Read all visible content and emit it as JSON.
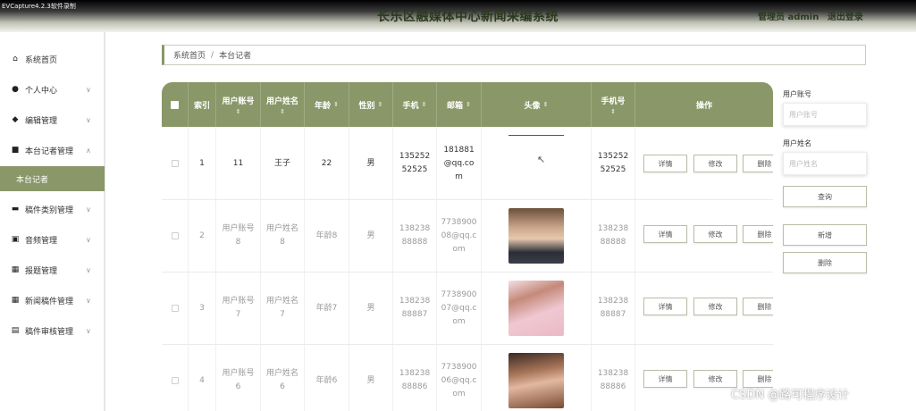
{
  "window": {
    "capture_label": "EVCapture4.2.3软件录制"
  },
  "header": {
    "title": "长乐区融媒体中心新闻采编系统",
    "user_role": "管理员 admin",
    "logout_label": "退出登录"
  },
  "sidebar": {
    "items": [
      {
        "label": "系统首页",
        "icon": "home-icon"
      },
      {
        "label": "个人中心",
        "icon": "user-icon"
      },
      {
        "label": "编辑管理",
        "icon": "edit-icon"
      },
      {
        "label": "本台记者管理",
        "icon": "reporter-icon"
      },
      {
        "label": "稿件类别管理",
        "icon": "category-icon"
      },
      {
        "label": "音频管理",
        "icon": "audio-icon"
      },
      {
        "label": "报题管理",
        "icon": "grid-icon"
      },
      {
        "label": "新闻稿件管理",
        "icon": "grid-icon"
      },
      {
        "label": "稿件审核管理",
        "icon": "review-icon"
      }
    ],
    "active_sub": "本台记者"
  },
  "breadcrumb": {
    "home": "系统首页",
    "separator": "/",
    "current": "本台记者"
  },
  "table": {
    "headers": {
      "index": "索引",
      "account": "用户账号",
      "name": "用户姓名",
      "age": "年龄",
      "gender": "性别",
      "phone": "手机",
      "email": "邮箱",
      "avatar": "头像",
      "phone_no": "手机号",
      "actions": "操作"
    },
    "rows": [
      {
        "index": "1",
        "account": "11",
        "name": "王子",
        "age": "22",
        "gender": "男",
        "phone": "13525252525",
        "email": "181881@qq.com",
        "phone_no": "13525252525"
      },
      {
        "index": "2",
        "account": "用户账号8",
        "name": "用户姓名8",
        "age": "年龄8",
        "gender": "男",
        "phone": "13823888888",
        "email": "773890008@qq.com",
        "phone_no": "13823888888"
      },
      {
        "index": "3",
        "account": "用户账号7",
        "name": "用户姓名7",
        "age": "年龄7",
        "gender": "男",
        "phone": "13823888887",
        "email": "773890007@qq.com",
        "phone_no": "13823888887"
      },
      {
        "index": "4",
        "account": "用户账号6",
        "name": "用户姓名6",
        "age": "年龄6",
        "gender": "男",
        "phone": "13823888886",
        "email": "773890006@qq.com",
        "phone_no": "13823888886"
      }
    ],
    "actions": {
      "detail": "详情",
      "edit": "修改",
      "delete": "删除"
    }
  },
  "search": {
    "account_label": "用户账号",
    "account_placeholder": "用户账号",
    "name_label": "用户姓名",
    "name_placeholder": "用户姓名",
    "query_button": "查询",
    "add_button": "新增",
    "delete_button": "删除"
  },
  "watermark": "CSDN @路可程序设计",
  "colors": {
    "accent": "#8a9768"
  }
}
